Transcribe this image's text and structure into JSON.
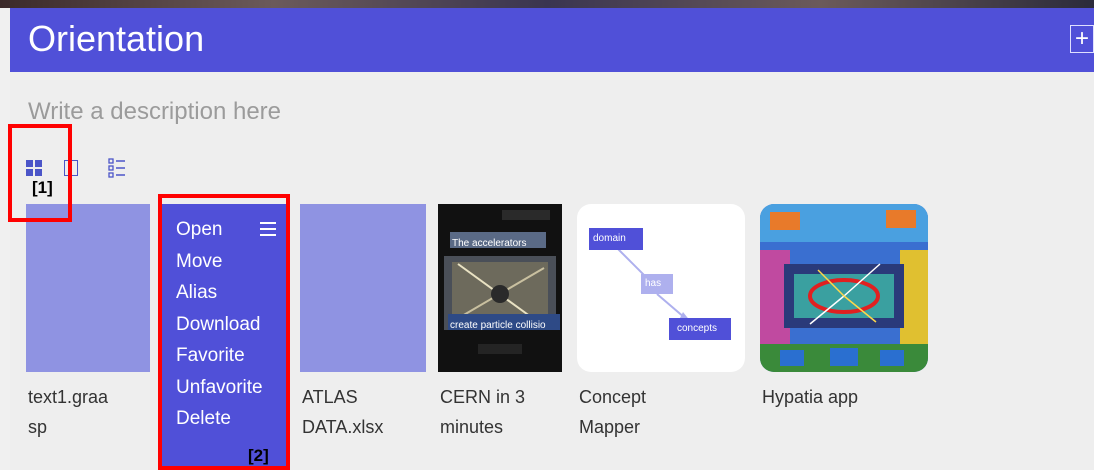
{
  "header": {
    "title": "Orientation",
    "add_icon": "+"
  },
  "description_placeholder": "Write a description here",
  "view_modes": [
    "grid-icon",
    "single-icon",
    "list-icon"
  ],
  "items": [
    {
      "name_line1": "text1.graa",
      "name_line2": "sp",
      "thumb": "lavender"
    },
    {
      "context_menu": [
        "Open",
        "Move",
        "Alias",
        "Download",
        "Favorite",
        "Unfavorite",
        "Delete"
      ]
    },
    {
      "name_line1": "ATLAS",
      "name_line2": "DATA.xlsx",
      "thumb": "lavender"
    },
    {
      "name_line1": "CERN in 3",
      "name_line2": "minutes",
      "thumb_caption_top": "The accelerators",
      "thumb_caption_bottom": "create particle collisio"
    },
    {
      "name_line1": "Concept",
      "name_line2": "Mapper",
      "nodes": [
        "domain",
        "has",
        "concepts"
      ]
    },
    {
      "name_line1": "Hypatia app",
      "name_line2": ""
    }
  ],
  "annotations": [
    "[1]",
    "[2]"
  ],
  "colors": {
    "accent": "#5050d8",
    "tile": "#8f93e2",
    "annotation": "#ff0000"
  }
}
